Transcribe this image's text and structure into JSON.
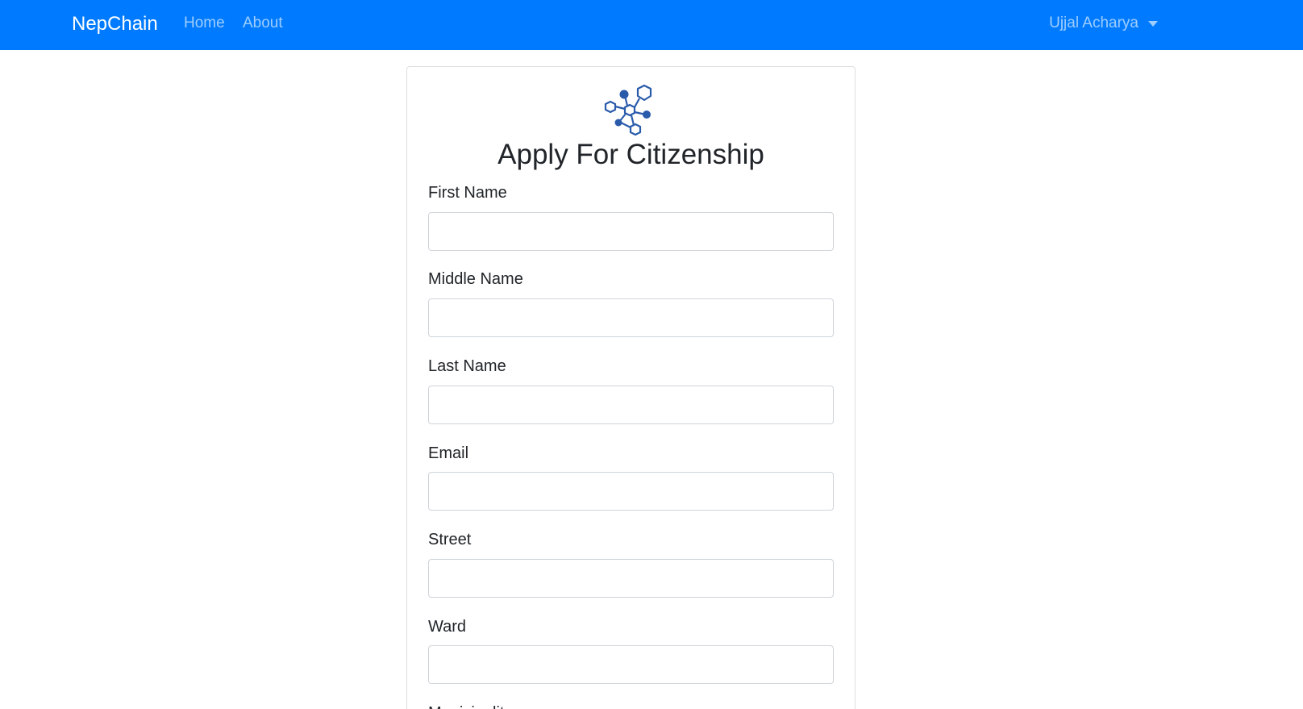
{
  "navbar": {
    "brand": "NepChain",
    "links": [
      "Home",
      "About"
    ],
    "user": "Ujjal Acharya"
  },
  "form": {
    "title": "Apply For Citizenship",
    "fields": [
      {
        "label": "First Name",
        "value": ""
      },
      {
        "label": "Middle Name",
        "value": ""
      },
      {
        "label": "Last Name",
        "value": ""
      },
      {
        "label": "Email",
        "value": ""
      },
      {
        "label": "Street",
        "value": ""
      },
      {
        "label": "Ward",
        "value": ""
      },
      {
        "label": "Municipality",
        "value": ""
      }
    ]
  },
  "icons": {
    "logo": "hexagon-network-icon",
    "dropdown": "caret-down-icon"
  },
  "colors": {
    "navbar": "#007bff",
    "logo": "#2a5bab"
  }
}
